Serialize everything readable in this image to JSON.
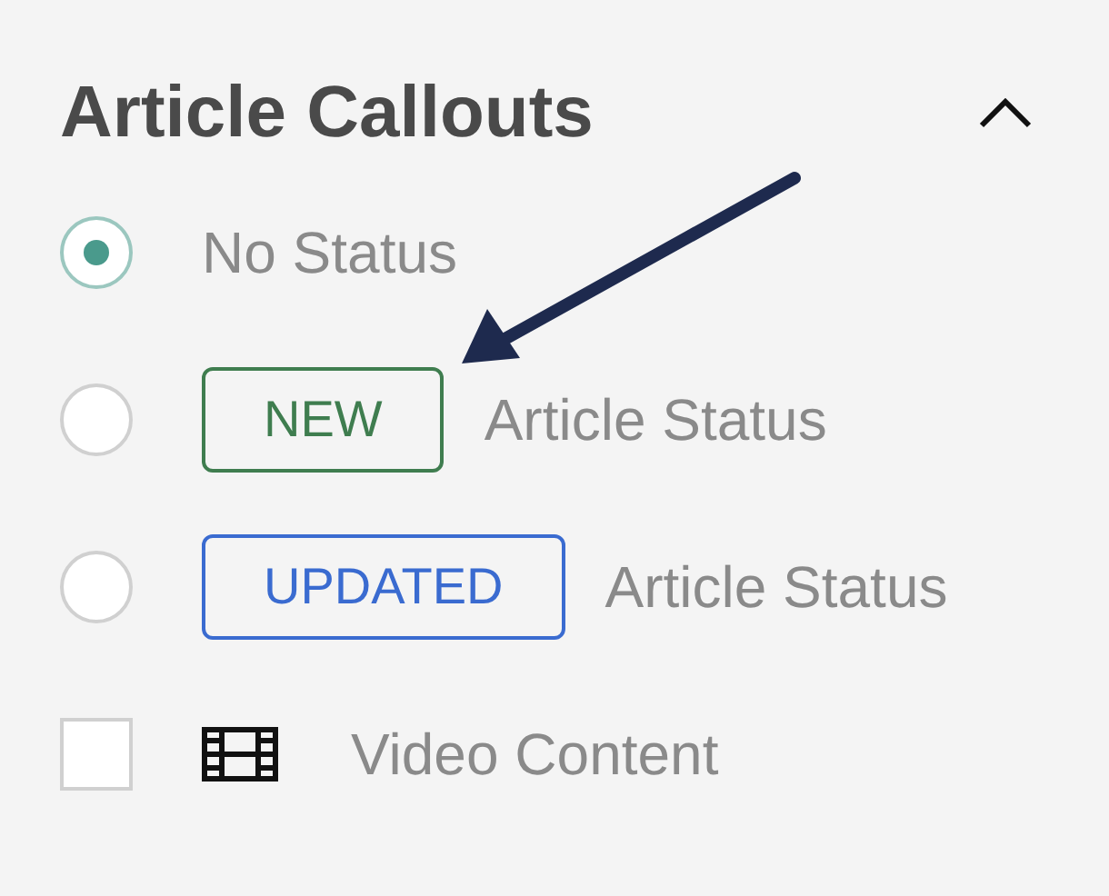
{
  "panel": {
    "title": "Article Callouts",
    "expanded": true
  },
  "options": [
    {
      "kind": "radio",
      "selected": true,
      "label": "No Status"
    },
    {
      "kind": "radio",
      "selected": false,
      "badge": {
        "text": "NEW",
        "color": "#3f7d4f"
      },
      "label": "Article Status"
    },
    {
      "kind": "radio",
      "selected": false,
      "badge": {
        "text": "UPDATED",
        "color": "#3a6bd0"
      },
      "label": "Article Status"
    },
    {
      "kind": "checkbox",
      "checked": false,
      "label": "Video Content"
    }
  ]
}
